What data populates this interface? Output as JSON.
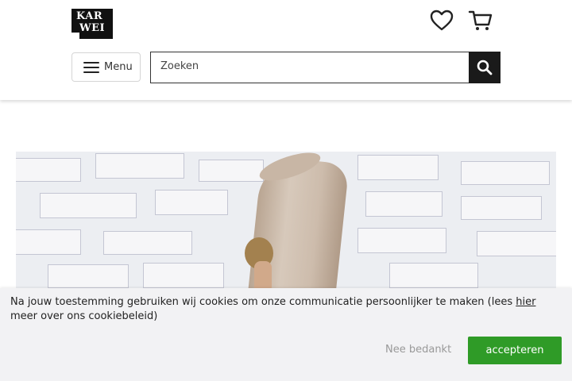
{
  "header": {
    "logo_line1": "KAR",
    "logo_line2": "WEI",
    "favorites_icon": "heart-icon",
    "cart_icon": "cart-icon",
    "menu_label": "Menu",
    "menu_icon": "hamburger-icon",
    "search_placeholder": "Zoeken",
    "search_value": "",
    "search_icon": "search-icon"
  },
  "hero": {
    "image": "person-carrying-rolled-rug-against-white-brick-wall"
  },
  "cookie_banner": {
    "text_before_link": "Na jouw toestemming gebruiken wij cookies om onze communicatie persoonlijker te maken (lees ",
    "link_text": "hier",
    "text_after_link": " meer over ons cookiebeleid)",
    "decline_label": "Nee bedankt",
    "accept_label": "accepteren",
    "accept_color": "#2f9b27"
  }
}
